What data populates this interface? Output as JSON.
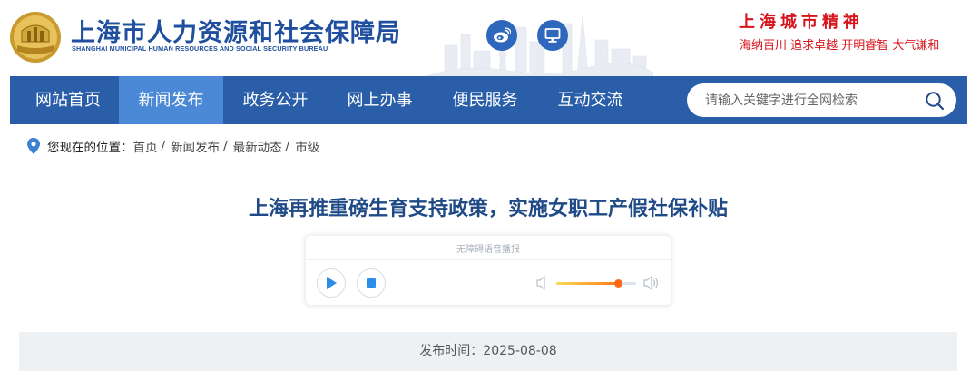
{
  "header": {
    "title": "上海市人力资源和社会保障局",
    "subtitle": "SHANGHAI MUNICIPAL HUMAN RESOURCES AND SOCIAL SECURITY BUREAU",
    "spirit_title": "上海城市精神",
    "spirit_line": "海纳百川 追求卓越 开明睿智 大气谦和",
    "icons": [
      "logo-emblem",
      "weibo-icon",
      "computer-icon"
    ]
  },
  "nav": {
    "items": [
      {
        "label": "网站首页",
        "active": false
      },
      {
        "label": "新闻发布",
        "active": true
      },
      {
        "label": "政务公开",
        "active": false
      },
      {
        "label": "网上办事",
        "active": false
      },
      {
        "label": "便民服务",
        "active": false
      },
      {
        "label": "互动交流",
        "active": false
      }
    ],
    "search_placeholder": "请输入关键字进行全网检索"
  },
  "breadcrumb": {
    "prefix": "您现在的位置：",
    "items": [
      "首页",
      "新闻发布",
      "最新动态",
      "市级"
    ],
    "separator": "/"
  },
  "article": {
    "title": "上海再推重磅生育支持政策，实施女职工产假社保补贴",
    "date_text": "发布时间：2025-08-08"
  },
  "player": {
    "label": "无障碍语音播报",
    "volume_percent": 77
  },
  "colors": {
    "brand_blue": "#2a5ea8",
    "nav_active": "#4b89d6",
    "title_blue": "#1f4a86",
    "spirit_red": "#d7141b",
    "volume_orange": "#ff6a16"
  }
}
